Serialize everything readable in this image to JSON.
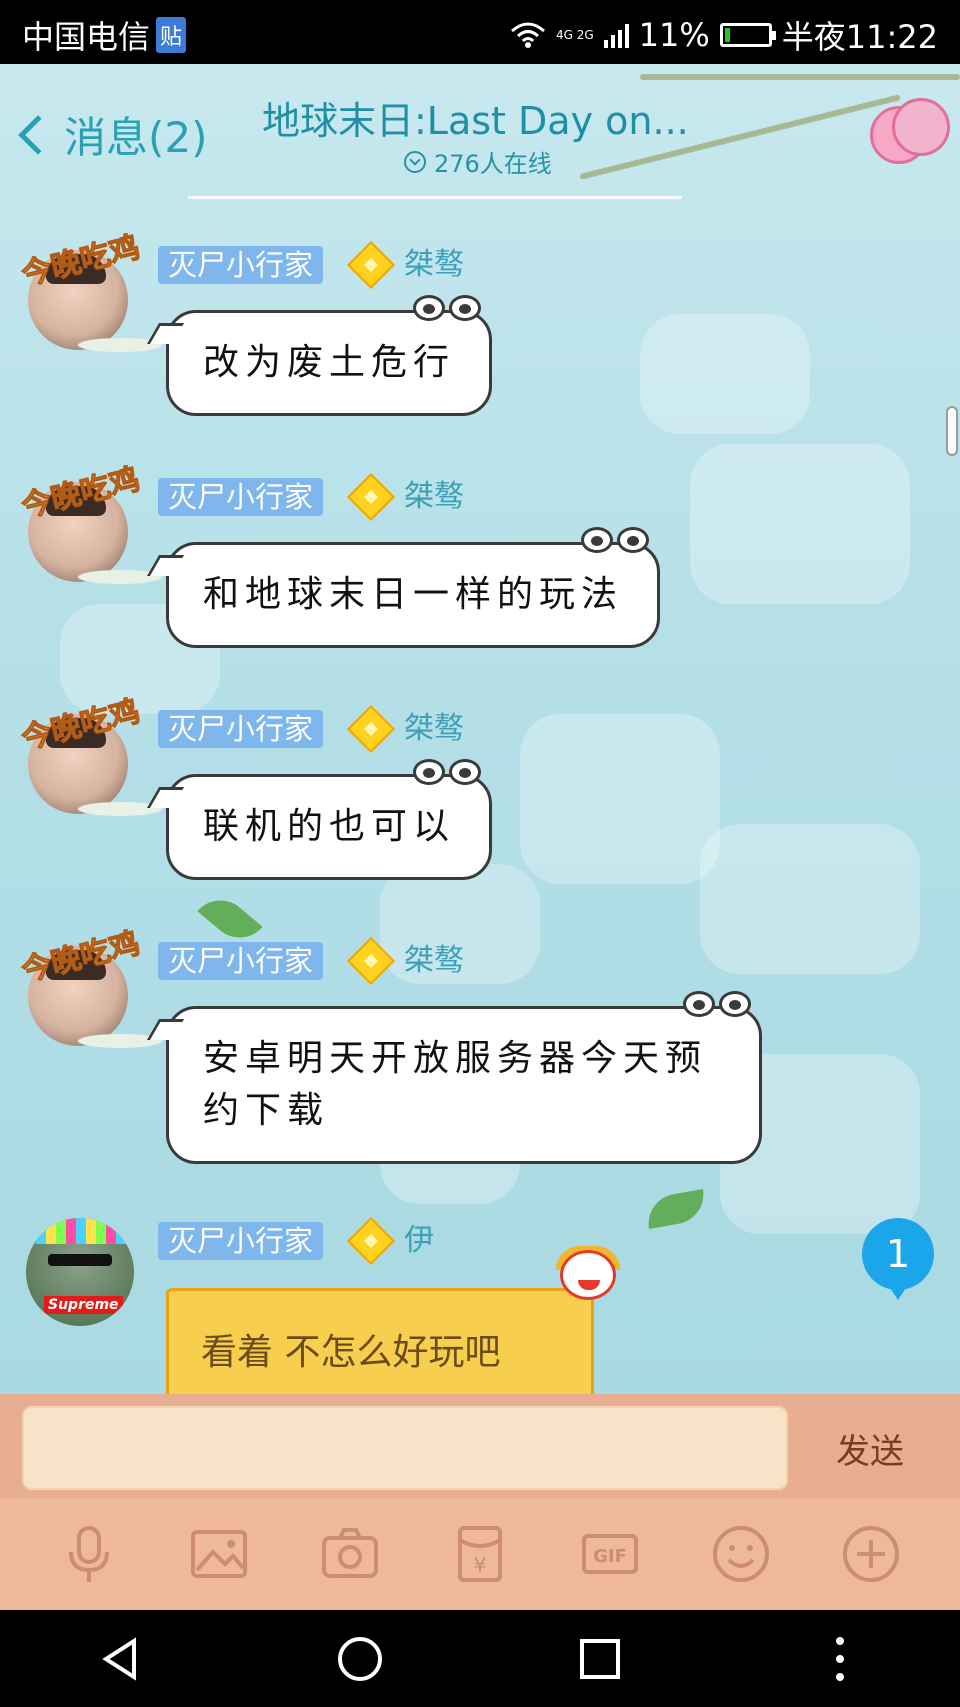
{
  "status_bar": {
    "carrier": "中国电信",
    "carrier_badge": "贴",
    "network": "4G 2G",
    "battery": "11%",
    "battery_level": 0.11,
    "time": "半夜11:22"
  },
  "header": {
    "back_label": "消息(2)",
    "title": "地球末日:Last Day on...",
    "online": "276人在线"
  },
  "messages": [
    {
      "tag": "灭尸小行家",
      "user": "桀骜",
      "avatar_text": "今晚吃鸡",
      "text": "改为废土危行"
    },
    {
      "tag": "灭尸小行家",
      "user": "桀骜",
      "avatar_text": "今晚吃鸡",
      "text": "和地球末日一样的玩法"
    },
    {
      "tag": "灭尸小行家",
      "user": "桀骜",
      "avatar_text": "今晚吃鸡",
      "text": "联机的也可以"
    },
    {
      "tag": "灭尸小行家",
      "user": "桀骜",
      "avatar_text": "今晚吃鸡",
      "text": "安卓明天开放服务器今天预约下载"
    },
    {
      "tag": "灭尸小行家",
      "user": "伊",
      "avatar_brand": "Supreme",
      "text": "看着  不怎么好玩吧"
    }
  ],
  "unread_count": "1",
  "input": {
    "value": "",
    "send_label": "发送"
  },
  "toolbar": {
    "items": [
      "microphone-icon",
      "image-icon",
      "camera-icon",
      "red-packet-icon",
      "gif-icon",
      "emoji-icon",
      "plus-icon"
    ],
    "gif_label": "GIF",
    "redpacket_label": "¥"
  },
  "navbar": {
    "items": [
      "back-icon",
      "home-icon",
      "recents-icon",
      "more-icon"
    ]
  },
  "colors": {
    "accent": "#29a0b4",
    "tag_bg": "#7fb6ec",
    "unread": "#1ca6ea",
    "input_bar": "#e7ae92"
  }
}
